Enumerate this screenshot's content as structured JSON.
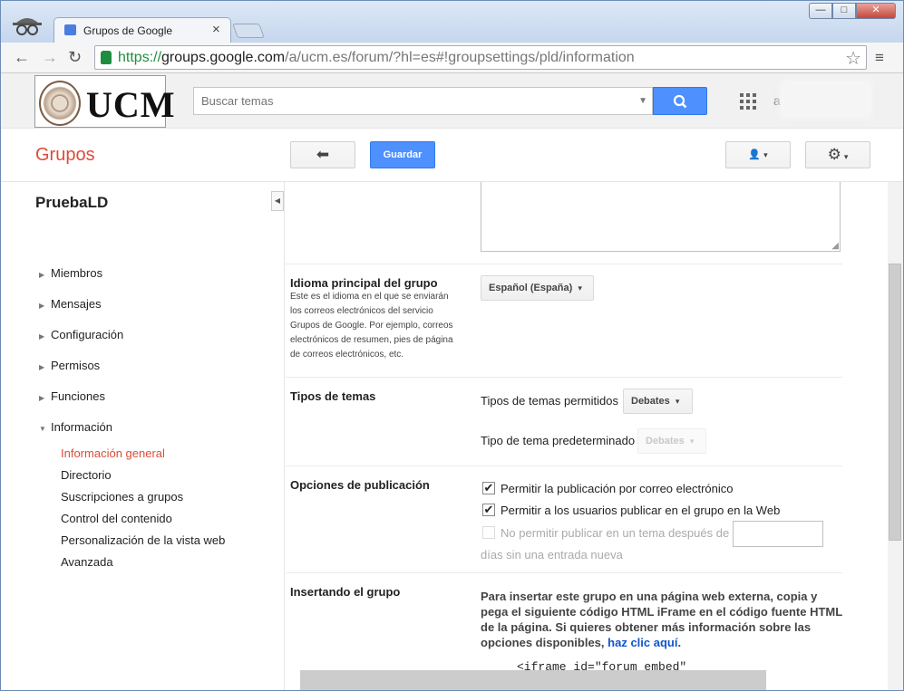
{
  "tab": {
    "title": "Grupos de Google",
    "close": "×"
  },
  "window": {
    "minimize": "—",
    "maximize": "□",
    "close": "✕"
  },
  "toolbar": {
    "back": "←",
    "forward": "→",
    "reload": "↻",
    "url_scheme": "https://",
    "url_host": "groups.google.com",
    "url_path": "/a/ucm.es/forum/?hl=es#!groupsettings/pld/information",
    "star": "☆",
    "menu": "≡"
  },
  "header": {
    "logo_text": "UCM",
    "search_placeholder": "Buscar temas",
    "account_initial": "a"
  },
  "apphdr": {
    "title": "Grupos",
    "back_icon": "⬅",
    "save_label": "Guardar",
    "member_icon": "👤",
    "gear_icon": "⚙",
    "caret": "▾"
  },
  "sidebar": {
    "group_name": "PruebaLD",
    "collapse": "◀",
    "items": [
      {
        "label": "Miembros",
        "arrow": "▶"
      },
      {
        "label": "Mensajes",
        "arrow": "▶"
      },
      {
        "label": "Configuración",
        "arrow": "▶"
      },
      {
        "label": "Permisos",
        "arrow": "▶"
      },
      {
        "label": "Funciones",
        "arrow": "▶"
      },
      {
        "label": "Información",
        "arrow": "▼"
      }
    ],
    "subitems": [
      {
        "label": "Información general"
      },
      {
        "label": "Directorio"
      },
      {
        "label": "Suscripciones a grupos"
      },
      {
        "label": "Control del contenido"
      },
      {
        "label": "Personalización de la vista web"
      },
      {
        "label": "Avanzada"
      }
    ]
  },
  "settings": {
    "language": {
      "label": "Idioma principal del grupo",
      "description": "Este es el idioma en el que se enviarán los correos electrónicos del servicio Grupos de Google. Por ejemplo, correos electrónicos de resumen, pies de página de correos electrónicos, etc.",
      "value": "Español (España)"
    },
    "topic_types": {
      "label": "Tipos de temas",
      "allowed_label": "Tipos de temas permitidos",
      "allowed_value": "Debates",
      "default_label": "Tipo de tema predeterminado",
      "default_value": "Debates"
    },
    "posting": {
      "label": "Opciones de publicación",
      "opt1": "Permitir la publicación por correo electrónico",
      "opt2": "Permitir a los usuarios publicar en el grupo en la Web",
      "opt3": "No permitir publicar en un tema después de",
      "opt3_suffix": "días sin una entrada nueva",
      "check": "✔"
    },
    "embed": {
      "label": "Insertando el grupo",
      "text": "Para insertar este grupo en una página web externa, copia y pega el siguiente código HTML iFrame en el código fuente HTML de la página. Si quieres obtener más información sobre las opciones disponibles,",
      "link": "haz clic aquí",
      "period": ".",
      "code": "<iframe id=\"forum_embed\""
    }
  }
}
